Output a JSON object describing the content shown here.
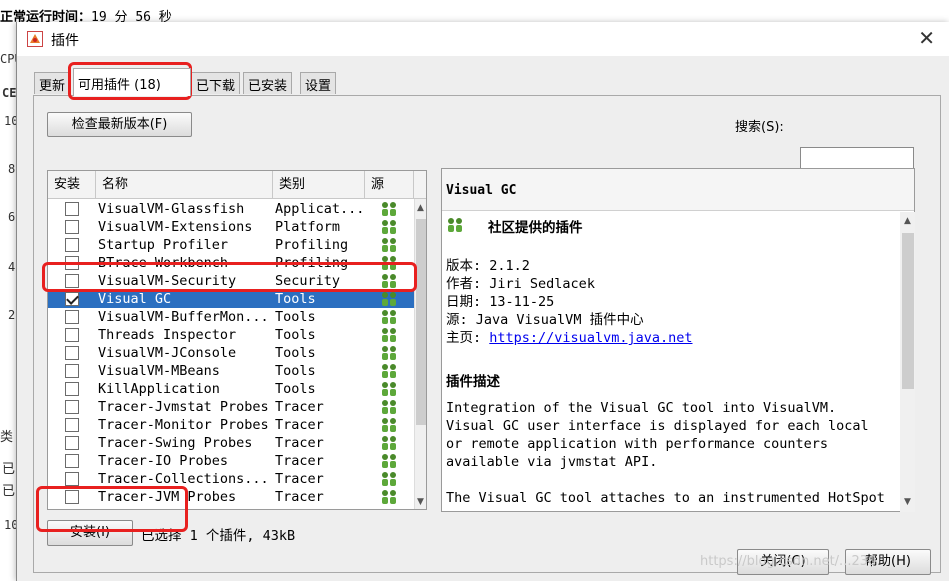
{
  "background": {
    "uptime_label": "正常运行时间：",
    "uptime_value": "19 分 56 秒",
    "fragments": [
      "CPU",
      "CE",
      "10",
      "8",
      "6",
      "4",
      "2",
      "类",
      "已",
      "已",
      "10"
    ]
  },
  "dialog": {
    "title": "插件",
    "tabs": [
      "更新",
      "可用插件 (18)",
      "已下载",
      "已安装",
      "设置"
    ],
    "check_button": "检查最新版本(F)",
    "search_label": "搜索(S):",
    "search_value": "",
    "columns": [
      "安装",
      "名称",
      "类别",
      "源"
    ],
    "rows": [
      {
        "checked": false,
        "name": "VisualVM-Glassfish",
        "category": "Applicat..."
      },
      {
        "checked": false,
        "name": "VisualVM-Extensions",
        "category": "Platform"
      },
      {
        "checked": false,
        "name": "Startup Profiler",
        "category": "Profiling"
      },
      {
        "checked": false,
        "name": "BTrace Workbench",
        "category": "Profiling"
      },
      {
        "checked": false,
        "name": "VisualVM-Security",
        "category": "Security"
      },
      {
        "checked": true,
        "name": "Visual GC",
        "category": "Tools",
        "selected": true
      },
      {
        "checked": false,
        "name": "VisualVM-BufferMon...",
        "category": "Tools"
      },
      {
        "checked": false,
        "name": "Threads Inspector",
        "category": "Tools"
      },
      {
        "checked": false,
        "name": "VisualVM-JConsole",
        "category": "Tools"
      },
      {
        "checked": false,
        "name": "VisualVM-MBeans",
        "category": "Tools"
      },
      {
        "checked": false,
        "name": "KillApplication",
        "category": "Tools"
      },
      {
        "checked": false,
        "name": "Tracer-Jvmstat Probes",
        "category": "Tracer"
      },
      {
        "checked": false,
        "name": "Tracer-Monitor Probes",
        "category": "Tracer"
      },
      {
        "checked": false,
        "name": "Tracer-Swing Probes",
        "category": "Tracer"
      },
      {
        "checked": false,
        "name": "Tracer-IO Probes",
        "category": "Tracer"
      },
      {
        "checked": false,
        "name": "Tracer-Collections...",
        "category": "Tracer"
      },
      {
        "checked": false,
        "name": "Tracer-JVM Probes",
        "category": "Tracer"
      }
    ],
    "detail": {
      "title": "Visual GC",
      "badge": "社区提供的插件",
      "version_label": "版本:",
      "version": "2.1.2",
      "author_label": "作者:",
      "author": "Jiri Sedlacek",
      "date_label": "日期:",
      "date": "13-11-25",
      "source_label": "源:",
      "source": "Java VisualVM 插件中心",
      "homepage_label": "主页:",
      "homepage": "https://visualvm.java.net",
      "desc_heading": "插件描述",
      "desc_lines": [
        "Integration of the Visual GC tool into VisualVM.",
        "Visual GC user interface is displayed for each local",
        "or remote application with performance counters",
        "available via jvmstat API.",
        "",
        "The Visual GC tool attaches to an instrumented HotSpot"
      ]
    },
    "install_button": "安装(I)",
    "selection_status": "已选择 1 个插件, 43kB",
    "close_button": "关闭(C)",
    "help_button": "帮助(H)",
    "watermark": "https://blog.csdn.net/...230"
  },
  "colors": {
    "selection": "#2b6fc0",
    "highlight": "#e8201f",
    "link": "#0000ee"
  },
  "icons": {
    "source": "community-people-icon",
    "app": "visualvm-icon"
  }
}
